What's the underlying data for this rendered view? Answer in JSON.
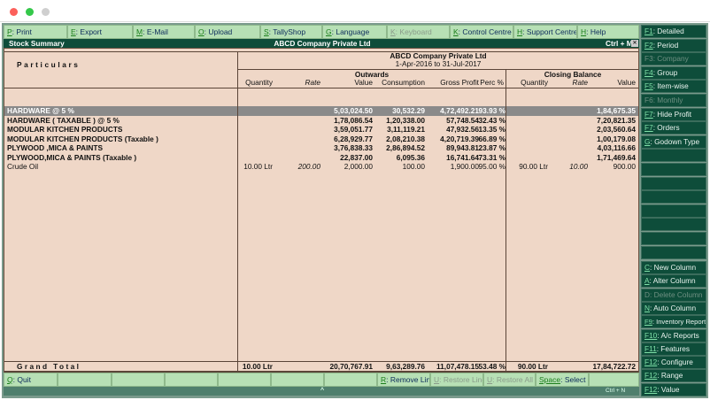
{
  "window": {
    "controls": [
      "close",
      "minimize",
      "maximize"
    ]
  },
  "toolbar": [
    {
      "key": "P",
      "label": ": Print",
      "enabled": true
    },
    {
      "key": "E",
      "label": ": Export",
      "enabled": true
    },
    {
      "key": "M",
      "label": ": E-Mail",
      "enabled": true
    },
    {
      "key": "O",
      "label": ": Upload",
      "enabled": true
    },
    {
      "key": "S",
      "label": ": TallyShop",
      "enabled": true
    },
    {
      "key": "G",
      "label": ": Language",
      "enabled": true
    },
    {
      "key": "K",
      "label": ": Keyboard",
      "enabled": false
    },
    {
      "key": "K",
      "label": ": Control Centre",
      "enabled": true
    },
    {
      "key": "H",
      "label": ": Support Centre",
      "enabled": true
    },
    {
      "key": "H",
      "label": ": Help",
      "enabled": true
    }
  ],
  "titlebar": {
    "left": "Stock Summary",
    "center": "ABCD Company Private Ltd",
    "shortcut": "Ctrl + M",
    "close": "✕"
  },
  "report": {
    "company": "ABCD Company Private Ltd",
    "period": "1-Apr-2016 to 31-Jul-2017",
    "particulars_header": "Particulars",
    "outwards_header": "Outwards",
    "closing_header": "Closing Balance",
    "columns": [
      "Quantity",
      "Rate",
      "Value",
      "Consumption",
      "Gross Profit",
      "Perc %",
      "Quantity",
      "Rate",
      "Value"
    ],
    "rows": [
      {
        "name": "HARDWARE @ 5 %",
        "bold": true,
        "selected": true,
        "cells": [
          "",
          "",
          "5,03,024.50",
          "30,532.29",
          "4,72,492.21",
          "93.93 %",
          "",
          "",
          "1,84,675.35"
        ]
      },
      {
        "name": "HARDWARE ( TAXABLE ) @ 5 %",
        "bold": true,
        "cells": [
          "",
          "",
          "1,78,086.54",
          "1,20,338.00",
          "57,748.54",
          "32.43 %",
          "",
          "",
          "7,20,821.35"
        ]
      },
      {
        "name": "MODULAR KITCHEN PRODUCTS",
        "bold": true,
        "cells": [
          "",
          "",
          "3,59,051.77",
          "3,11,119.21",
          "47,932.56",
          "13.35 %",
          "",
          "",
          "2,03,560.64"
        ]
      },
      {
        "name": "MODULAR KITCHEN PRODUCTS (Taxable )",
        "bold": true,
        "cells": [
          "",
          "",
          "6,28,929.77",
          "2,08,210.38",
          "4,20,719.39",
          "66.89 %",
          "",
          "",
          "1,00,179.08"
        ]
      },
      {
        "name": "PLYWOOD ,MICA & PAINTS",
        "bold": true,
        "cells": [
          "",
          "",
          "3,76,838.33",
          "2,86,894.52",
          "89,943.81",
          "23.87 %",
          "",
          "",
          "4,03,116.66"
        ]
      },
      {
        "name": "PLYWOOD,MICA & PAINTS (Taxable )",
        "bold": true,
        "cells": [
          "",
          "",
          "22,837.00",
          "6,095.36",
          "16,741.64",
          "73.31 %",
          "",
          "",
          "1,71,469.64"
        ]
      },
      {
        "name": "Crude Oil",
        "bold": false,
        "cells": [
          "10.00 Ltr",
          "200.00",
          "2,000.00",
          "100.00",
          "1,900.00",
          "95.00 %",
          "90.00 Ltr",
          "10.00",
          "900.00"
        ]
      }
    ],
    "total": {
      "label": "Grand Total",
      "cells": [
        "10.00 Ltr",
        "",
        "20,70,767.91",
        "9,63,289.76",
        "11,07,478.15",
        "53.48 %",
        "90.00 Ltr",
        "",
        "17,84,722.72"
      ]
    }
  },
  "sidebar_top": [
    {
      "key": "F1",
      "label": ": Detailed",
      "enabled": true
    },
    {
      "key": "F2",
      "label": ": Period",
      "enabled": true
    },
    {
      "key": "F3",
      "label": ": Company",
      "enabled": false
    },
    {
      "key": "F4",
      "label": ": Group",
      "enabled": true
    },
    {
      "key": "F5",
      "label": ": Item-wise",
      "enabled": true
    },
    {
      "key": "F6",
      "label": ": Monthly",
      "enabled": false
    },
    {
      "key": "F7",
      "label": ": Hide Profit",
      "enabled": true
    },
    {
      "key": "F7",
      "label": ": Orders",
      "enabled": true
    },
    {
      "key": "G",
      "label": ": Godown Type",
      "enabled": true
    }
  ],
  "sidebar_bottom": [
    {
      "key": "C",
      "label": ": New Column",
      "enabled": true
    },
    {
      "key": "A",
      "label": ": Alter Column",
      "enabled": true
    },
    {
      "key": "D",
      "label": ": Delete Column",
      "enabled": false
    },
    {
      "key": "N",
      "label": ": Auto Column",
      "enabled": true
    },
    {
      "key": "F9",
      "label": ": Inventory Reports",
      "enabled": true
    },
    {
      "key": "F10",
      "label": ": A/c Reports",
      "enabled": true
    },
    {
      "key": "F11",
      "label": ": Features",
      "enabled": true
    },
    {
      "key": "F12",
      "label": ": Configure",
      "enabled": true
    },
    {
      "key": "F12",
      "label": ": Range",
      "enabled": true
    },
    {
      "key": "F12",
      "label": ": Value",
      "enabled": true
    }
  ],
  "bottombar": [
    {
      "key": "Q",
      "label": ": Quit",
      "enabled": true
    },
    {
      "key": "",
      "label": "",
      "enabled": true
    },
    {
      "key": "",
      "label": "",
      "enabled": true
    },
    {
      "key": "",
      "label": "",
      "enabled": true
    },
    {
      "key": "",
      "label": "",
      "enabled": true
    },
    {
      "key": "",
      "label": "",
      "enabled": true
    },
    {
      "key": "",
      "label": "",
      "enabled": true
    },
    {
      "key": "R",
      "label": ": Remove Line",
      "enabled": true
    },
    {
      "key": "U",
      "label": ": Restore Line",
      "enabled": false
    },
    {
      "key": "U",
      "label": ": Restore All",
      "enabled": false
    },
    {
      "key": "Space",
      "label": ": Select",
      "enabled": true
    },
    {
      "key": "",
      "label": "",
      "enabled": true
    }
  ],
  "status": {
    "caret": "^",
    "shortcut": "Ctrl + N"
  },
  "colors": {
    "panel": "#efd7c7",
    "button": "#b7e0b5",
    "sidebar": "#0e4d3a",
    "selected_row": "#8a8a8a"
  }
}
